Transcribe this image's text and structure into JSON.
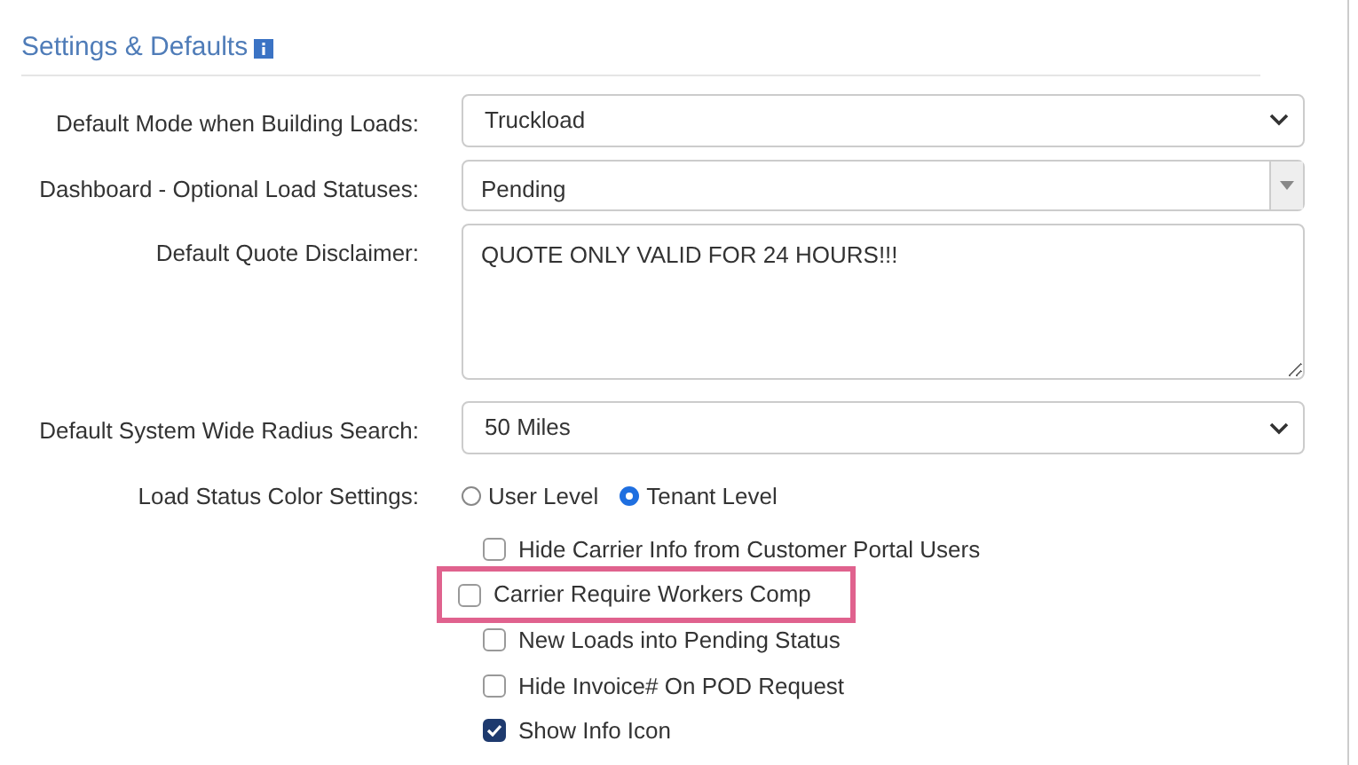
{
  "section": {
    "title": "Settings & Defaults"
  },
  "fields": [
    {
      "kind": "select",
      "label": "Default Mode when Building Loads:",
      "value": "Truckload"
    },
    {
      "kind": "combo",
      "label": "Dashboard - Optional Load Statuses:",
      "value": "Pending"
    },
    {
      "kind": "textarea",
      "label": "Default Quote Disclaimer:",
      "value": "QUOTE ONLY VALID FOR 24 HOURS!!!"
    },
    {
      "kind": "select",
      "label": "Default System Wide Radius Search:",
      "value": "50 Miles"
    },
    {
      "kind": "radio",
      "label": "Load Status Color Settings:",
      "options": [
        {
          "label": "User Level",
          "selected": false
        },
        {
          "label": "Tenant Level",
          "selected": true
        }
      ]
    }
  ],
  "checkboxes": [
    {
      "label": "Hide Carrier Info from Customer Portal Users",
      "checked": false,
      "highlighted": false
    },
    {
      "label": "Carrier Require Workers Comp",
      "checked": false,
      "highlighted": true
    },
    {
      "label": "New Loads into Pending Status",
      "checked": false,
      "highlighted": false
    },
    {
      "label": "Hide Invoice# On POD Request",
      "checked": false,
      "highlighted": false
    },
    {
      "label": "Show Info Icon",
      "checked": true,
      "highlighted": false
    }
  ]
}
